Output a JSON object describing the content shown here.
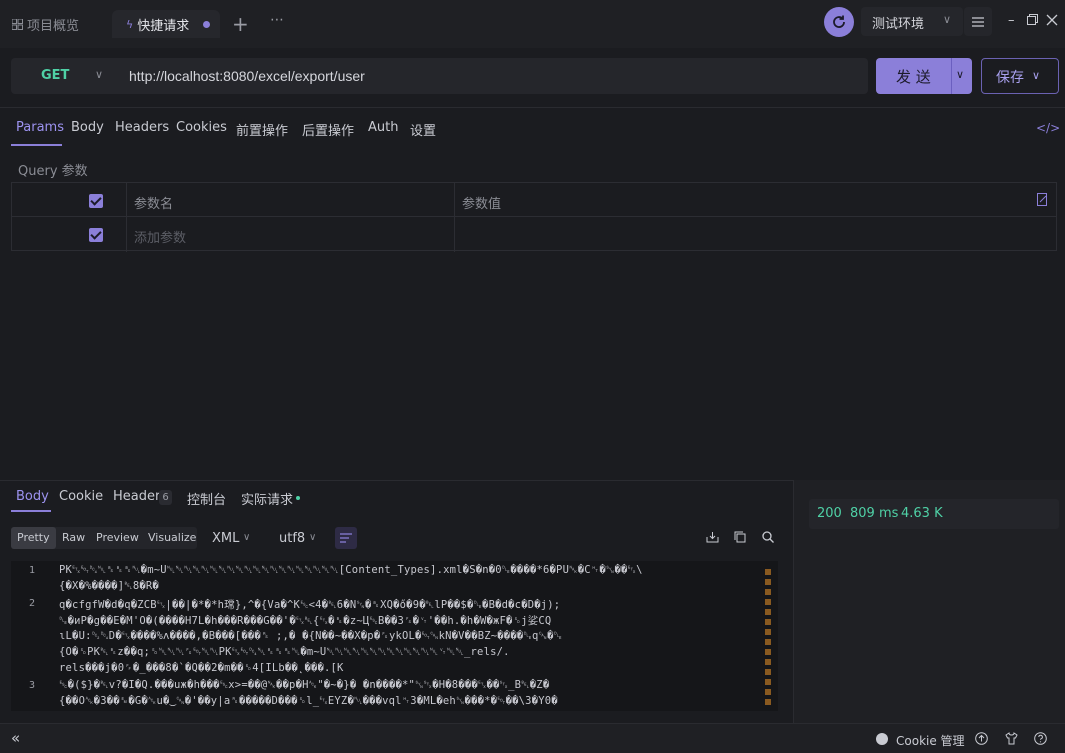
{
  "tabs": [
    {
      "label": "项目概览"
    },
    {
      "label": "快捷请求"
    }
  ],
  "env": {
    "label": "测试环境"
  },
  "request": {
    "method": "GET",
    "url": "http://localhost:8080/excel/export/user",
    "send_label": "发 送",
    "save_label": "保存"
  },
  "req_tabs": [
    "Params",
    "Body",
    "Headers",
    "Cookies",
    "前置操作",
    "后置操作",
    "Auth",
    "设置"
  ],
  "params": {
    "section_label": "Query 参数",
    "col_name": "参数名",
    "col_value": "参数值",
    "add_placeholder": "添加参数"
  },
  "response": {
    "tabs": [
      "Body",
      "Cookie",
      "Header",
      "控制台",
      "实际请求"
    ],
    "header_count": "6",
    "formats": [
      "Pretty",
      "Raw",
      "Preview",
      "Visualize"
    ],
    "type": "XML",
    "encoding": "utf8",
    "lines": [
      {
        "num": "1",
        "text": "PK␃␄␔␀␈␈␈␀�m~U␀␀␀␀␀␀␀␀␀␀␀␀␀␀␀␀␀␀␀␀[Content_Types].xml�S�n�0␐����*6�PU␕�C␉�␖��␃\\"
      },
      {
        "num": "",
        "text": "{�X�%����]␇8�R�"
      },
      {
        "num": "2",
        "text": "q�cfgfW�d�q�ZCB␃|��|�*�*h瑺},^�{Va�^K␛<4�␇6�N␖�␈XQ�ő�9�␇lP��$�␐�B�d�c�D�j);"
      },
      {
        "num": "",
        "text": "␐�иP�g��E�M'O�(����H7L�h���R���G��'�␃␇{␃�␈�z~Ц␛B��3␜�␋'��h.�h�W�жF�␎j娑CQ"
      },
      {
        "num": "",
        "text": "ɩL�U:␒␔D�␃����%ʌ����,�B���[���␞ ;,� �{N��~��X�p�␜ykOL�␄␘kN�V��BZ~����␐q␘�␐"
      },
      {
        "num": "",
        "text": "{O�␎PK␇␈z��q;␎␀␀␀␜␄␀␀PK␃␄␔␀␈␈␈␀�m~U␀␀␀␀␀␀␀␀␀␀␀␀␀␋␀␀_rels/."
      },
      {
        "num": "",
        "text": "rels���j�0␌�_���8�`�Q��2�m��␎4[ILb��˛���.[K"
      },
      {
        "num": "3",
        "text": "␛�($}�␇v?�I�Q.���uж�h���␛x>=��@␕��p�H␆\"�~�}�   �n����*\"␖␂�H�8���␃��␂_B␇�Z�"
      },
      {
        "num": "",
        "text": "{��O␆�3��␙�G�␆u�‿␘�'��y|a␞�����D���␎l_␃EYZ�␀���vql␉3�ML�eh␖���*�␄��\\3�Y0�"
      }
    ]
  },
  "status": {
    "code": "200",
    "time": "809 ms",
    "size": "4.63 K"
  },
  "footer": {
    "cookie_label": "Cookie 管理"
  },
  "colors": {
    "accent": "#8b7fd9",
    "success": "#4fd1a6"
  }
}
